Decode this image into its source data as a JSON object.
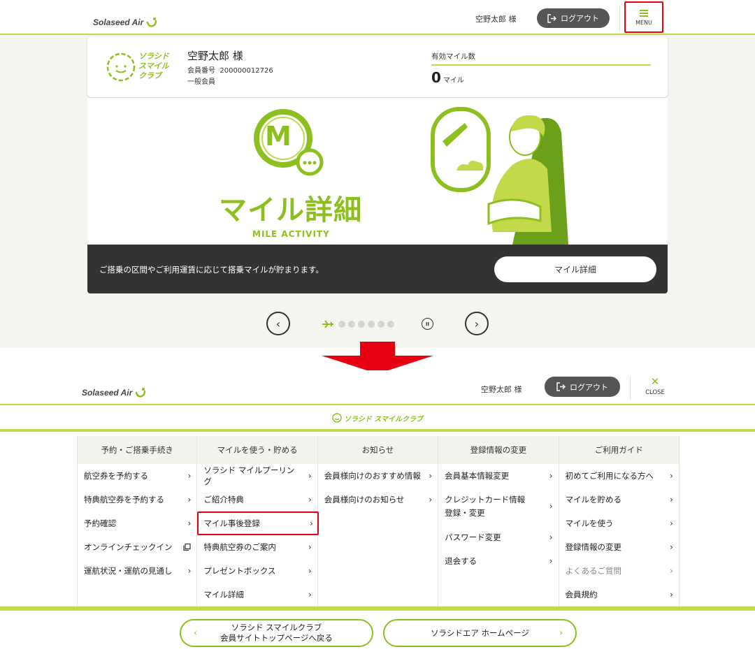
{
  "brand": {
    "name": "Solaseed Air",
    "accent": "#8dbf1f",
    "highlight": "#e60012"
  },
  "top": {
    "header": {
      "user": "空野太郎 様",
      "logout": "ログアウト",
      "menu": "MENU"
    },
    "member_card": {
      "club_logo_lines": [
        "ソラシド",
        "スマイル",
        "クラブ"
      ],
      "name": "空野太郎 様",
      "member_no_label": "会員番号",
      "member_no": "200000012726",
      "member_type": "一般会員",
      "miles_label": "有効マイル数",
      "miles_value": "0",
      "miles_unit": "マイル"
    },
    "banner": {
      "title": "マイル詳細",
      "subtitle": "MILE ACTIVITY",
      "badge_letter": "M",
      "description": "ご搭乗の区間やご利用運賃に応じて搭乗マイルが貯まります。",
      "button": "マイル詳細"
    },
    "carousel": {
      "prev": "‹",
      "next": "›",
      "pause": "II",
      "dot_count": 6
    }
  },
  "bottom": {
    "header": {
      "user": "空野太郎 様",
      "logout": "ログアウト",
      "close": "CLOSE"
    },
    "club_band": "ソラシド スマイルクラブ",
    "columns": [
      {
        "heading": "予約・ご搭乗手続き",
        "items": [
          "航空券を予約する",
          "特典航空券を予約する",
          "予約確認",
          "オンラインチェックイン",
          "運航状況・運航の見通し"
        ]
      },
      {
        "heading": "マイルを使う・貯める",
        "items": [
          "ソラシド マイルプーリング",
          "ご紹介特典",
          "マイル事後登録",
          "特典航空券のご案内",
          "プレゼントボックス",
          "マイル詳細"
        ]
      },
      {
        "heading": "お知らせ",
        "items": [
          "会員様向けのおすすめ情報",
          "会員様向けのお知らせ"
        ]
      },
      {
        "heading": "登録情報の変更",
        "items": [
          "会員基本情報変更",
          "クレジットカード情報",
          "登録・変更",
          "パスワード変更",
          "退会する"
        ]
      },
      {
        "heading": "ご利用ガイド",
        "items": [
          "初めてご利用になる方へ",
          "マイルを貯める",
          "マイルを使う",
          "登録情報の変更",
          "よくあるご質問",
          "会員規約"
        ]
      }
    ],
    "footer": {
      "back_line1": "ソラシド スマイルクラブ",
      "back_line2": "会員サイトトップページへ戻る",
      "homepage": "ソラシドエア ホームページ"
    }
  }
}
